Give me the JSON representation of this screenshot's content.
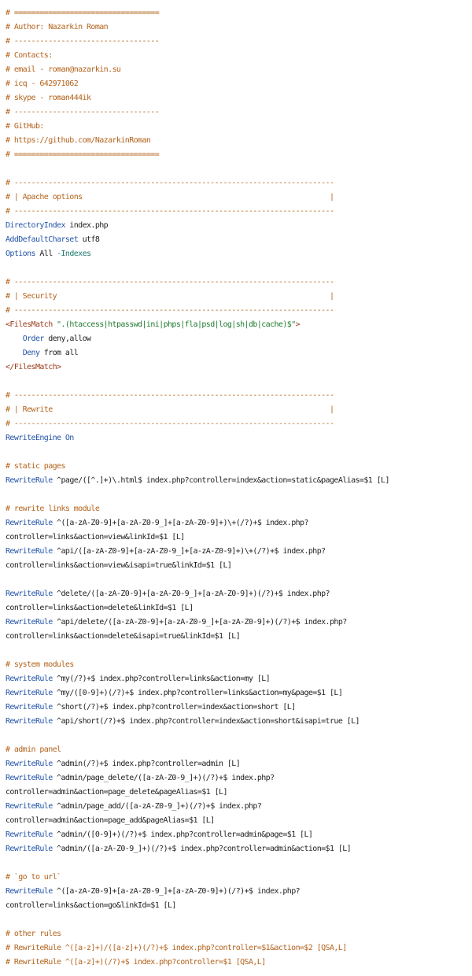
{
  "colors": {
    "comment": "#b3631c",
    "directive": "#2353a8",
    "plain": "#222222",
    "tag": "#9a3a1a",
    "string": "#1f7a2e",
    "option": "#1f7a6e"
  },
  "lines": [
    [
      {
        "t": "# ==================================",
        "k": "comment"
      }
    ],
    [
      {
        "t": "# Author: Nazarkin Roman",
        "k": "comment"
      }
    ],
    [
      {
        "t": "# ----------------------------------",
        "k": "comment"
      }
    ],
    [
      {
        "t": "# Contacts:",
        "k": "comment"
      }
    ],
    [
      {
        "t": "# email - roman@nazarkin.su",
        "k": "comment"
      }
    ],
    [
      {
        "t": "# icq - 642971062",
        "k": "comment"
      }
    ],
    [
      {
        "t": "# skype - roman444ik",
        "k": "comment"
      }
    ],
    [
      {
        "t": "# ----------------------------------",
        "k": "comment"
      }
    ],
    [
      {
        "t": "# GitHub:",
        "k": "comment"
      }
    ],
    [
      {
        "t": "# https://github.com/NazarkinRoman",
        "k": "comment"
      }
    ],
    [
      {
        "t": "# ==================================",
        "k": "comment"
      }
    ],
    [
      {
        "t": "",
        "k": "plain"
      }
    ],
    [
      {
        "t": "# ---------------------------------------------------------------------------",
        "k": "comment"
      }
    ],
    [
      {
        "t": "# | Apache options                                                          |",
        "k": "comment"
      }
    ],
    [
      {
        "t": "# ---------------------------------------------------------------------------",
        "k": "comment"
      }
    ],
    [
      {
        "t": "DirectoryIndex",
        "k": "directive"
      },
      {
        "t": " index.php",
        "k": "plain"
      }
    ],
    [
      {
        "t": "AddDefaultCharset",
        "k": "directive"
      },
      {
        "t": " utf8",
        "k": "plain"
      }
    ],
    [
      {
        "t": "Options",
        "k": "directive"
      },
      {
        "t": " All ",
        "k": "plain"
      },
      {
        "t": "-Indexes",
        "k": "option"
      }
    ],
    [
      {
        "t": "",
        "k": "plain"
      }
    ],
    [
      {
        "t": "# ---------------------------------------------------------------------------",
        "k": "comment"
      }
    ],
    [
      {
        "t": "# | Security                                                                |",
        "k": "comment"
      }
    ],
    [
      {
        "t": "# ---------------------------------------------------------------------------",
        "k": "comment"
      }
    ],
    [
      {
        "t": "<FilesMatch",
        "k": "tag"
      },
      {
        "t": " \".(htaccess|htpasswd|ini|phps|fla|psd|log|sh|db|cache)$\"",
        "k": "string"
      },
      {
        "t": ">",
        "k": "tag"
      }
    ],
    [
      {
        "t": "    ",
        "k": "plain"
      },
      {
        "t": "Order",
        "k": "directive"
      },
      {
        "t": " deny,allow",
        "k": "plain"
      }
    ],
    [
      {
        "t": "    ",
        "k": "plain"
      },
      {
        "t": "Deny",
        "k": "directive"
      },
      {
        "t": " from all",
        "k": "plain"
      }
    ],
    [
      {
        "t": "</FilesMatch>",
        "k": "tag"
      }
    ],
    [
      {
        "t": "",
        "k": "plain"
      }
    ],
    [
      {
        "t": "# ---------------------------------------------------------------------------",
        "k": "comment"
      }
    ],
    [
      {
        "t": "# | Rewrite                                                                 |",
        "k": "comment"
      }
    ],
    [
      {
        "t": "# ---------------------------------------------------------------------------",
        "k": "comment"
      }
    ],
    [
      {
        "t": "RewriteEngine",
        "k": "directive"
      },
      {
        "t": " ",
        "k": "plain"
      },
      {
        "t": "On",
        "k": "directive"
      }
    ],
    [
      {
        "t": "",
        "k": "plain"
      }
    ],
    [
      {
        "t": "# static pages",
        "k": "comment"
      }
    ],
    [
      {
        "t": "RewriteRule",
        "k": "directive"
      },
      {
        "t": " ^page/([^.]+)\\.html$ index.php?controller=index&action=static&pageAlias=$1 [L]",
        "k": "plain"
      }
    ],
    [
      {
        "t": "",
        "k": "plain"
      }
    ],
    [
      {
        "t": "# rewrite links module",
        "k": "comment"
      }
    ],
    [
      {
        "t": "RewriteRule",
        "k": "directive"
      },
      {
        "t": " ^([a-zA-Z0-9]+[a-zA-Z0-9_]+[a-zA-Z0-9]+)\\+(/?)+$ index.php?",
        "k": "plain"
      }
    ],
    [
      {
        "t": "controller=links&action=view&linkId=$1 [L]",
        "k": "plain"
      }
    ],
    [
      {
        "t": "RewriteRule",
        "k": "directive"
      },
      {
        "t": " ^api/([a-zA-Z0-9]+[a-zA-Z0-9_]+[a-zA-Z0-9]+)\\+(/?)+$ index.php?",
        "k": "plain"
      }
    ],
    [
      {
        "t": "controller=links&action=view&isapi=true&linkId=$1 [L]",
        "k": "plain"
      }
    ],
    [
      {
        "t": "",
        "k": "plain"
      }
    ],
    [
      {
        "t": "RewriteRule",
        "k": "directive"
      },
      {
        "t": " ^delete/([a-zA-Z0-9]+[a-zA-Z0-9_]+[a-zA-Z0-9]+)(/?)+$ index.php?",
        "k": "plain"
      }
    ],
    [
      {
        "t": "controller=links&action=delete&linkId=$1 [L]",
        "k": "plain"
      }
    ],
    [
      {
        "t": "RewriteRule",
        "k": "directive"
      },
      {
        "t": " ^api/delete/([a-zA-Z0-9]+[a-zA-Z0-9_]+[a-zA-Z0-9]+)(/?)+$ index.php?",
        "k": "plain"
      }
    ],
    [
      {
        "t": "controller=links&action=delete&isapi=true&linkId=$1 [L]",
        "k": "plain"
      }
    ],
    [
      {
        "t": "",
        "k": "plain"
      }
    ],
    [
      {
        "t": "# system modules",
        "k": "comment"
      }
    ],
    [
      {
        "t": "RewriteRule",
        "k": "directive"
      },
      {
        "t": " ^my(/?)+$ index.php?controller=links&action=my [L]",
        "k": "plain"
      }
    ],
    [
      {
        "t": "RewriteRule",
        "k": "directive"
      },
      {
        "t": " ^my/([0-9]+)(/?)+$ index.php?controller=links&action=my&page=$1 [L]",
        "k": "plain"
      }
    ],
    [
      {
        "t": "RewriteRule",
        "k": "directive"
      },
      {
        "t": " ^short(/?)+$ index.php?controller=index&action=short [L]",
        "k": "plain"
      }
    ],
    [
      {
        "t": "RewriteRule",
        "k": "directive"
      },
      {
        "t": " ^api/short(/?)+$ index.php?controller=index&action=short&isapi=true [L]",
        "k": "plain"
      }
    ],
    [
      {
        "t": "",
        "k": "plain"
      }
    ],
    [
      {
        "t": "# admin panel",
        "k": "comment"
      }
    ],
    [
      {
        "t": "RewriteRule",
        "k": "directive"
      },
      {
        "t": " ^admin(/?)+$ index.php?controller=admin [L]",
        "k": "plain"
      }
    ],
    [
      {
        "t": "RewriteRule",
        "k": "directive"
      },
      {
        "t": " ^admin/page_delete/([a-zA-Z0-9_]+)(/?)+$ index.php?",
        "k": "plain"
      }
    ],
    [
      {
        "t": "controller=admin&action=page_delete&pageAlias=$1 [L]",
        "k": "plain"
      }
    ],
    [
      {
        "t": "RewriteRule",
        "k": "directive"
      },
      {
        "t": " ^admin/page_add/([a-zA-Z0-9_]+)(/?)+$ index.php?",
        "k": "plain"
      }
    ],
    [
      {
        "t": "controller=admin&action=page_add&pageAlias=$1 [L]",
        "k": "plain"
      }
    ],
    [
      {
        "t": "RewriteRule",
        "k": "directive"
      },
      {
        "t": " ^admin/([0-9]+)(/?)+$ index.php?controller=admin&page=$1 [L]",
        "k": "plain"
      }
    ],
    [
      {
        "t": "RewriteRule",
        "k": "directive"
      },
      {
        "t": " ^admin/([a-zA-Z0-9_]+)(/?)+$ index.php?controller=admin&action=$1 [L]",
        "k": "plain"
      }
    ],
    [
      {
        "t": "",
        "k": "plain"
      }
    ],
    [
      {
        "t": "# `go to url`",
        "k": "comment"
      }
    ],
    [
      {
        "t": "RewriteRule",
        "k": "directive"
      },
      {
        "t": " ^([a-zA-Z0-9]+[a-zA-Z0-9_]+[a-zA-Z0-9]+)(/?)+$ index.php?",
        "k": "plain"
      }
    ],
    [
      {
        "t": "controller=links&action=go&linkId=$1 [L]",
        "k": "plain"
      }
    ],
    [
      {
        "t": "",
        "k": "plain"
      }
    ],
    [
      {
        "t": "# other rules",
        "k": "comment"
      }
    ],
    [
      {
        "t": "# RewriteRule ^([a-z]+)/([a-z]+)(/?)+$ index.php?controller=$1&action=$2 [QSA,L]",
        "k": "comment"
      }
    ],
    [
      {
        "t": "# RewriteRule ^([a-z]+)(/?)+$ index.php?controller=$1 [QSA,L]",
        "k": "comment"
      }
    ]
  ]
}
